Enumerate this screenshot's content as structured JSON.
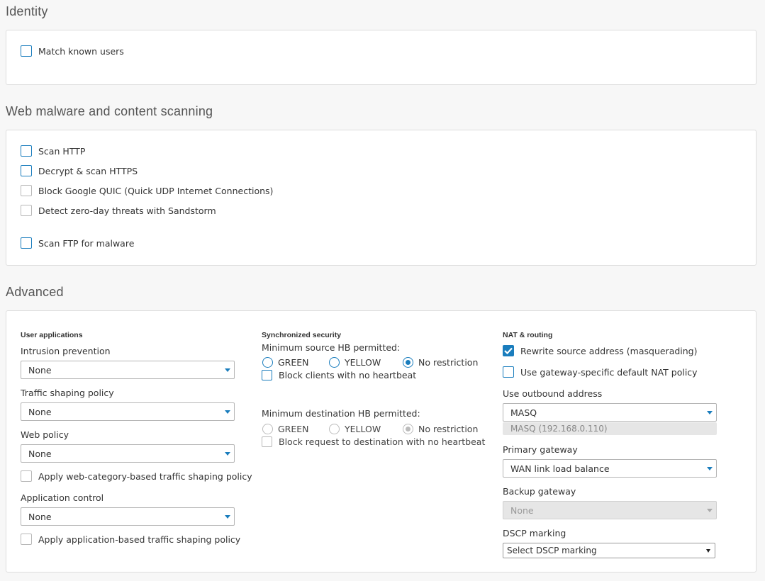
{
  "identity": {
    "title": "Identity",
    "match_known_users": "Match known users"
  },
  "scanning": {
    "title": "Web malware and content scanning",
    "scan_http": "Scan HTTP",
    "decrypt_https": "Decrypt & scan HTTPS",
    "block_quic": "Block Google QUIC (Quick UDP Internet Connections)",
    "zero_day": "Detect zero-day threats with Sandstorm",
    "scan_ftp": "Scan FTP for malware"
  },
  "advanced": {
    "title": "Advanced",
    "user_apps": {
      "heading": "User applications",
      "intrusion_label": "Intrusion prevention",
      "intrusion_value": "None",
      "traffic_label": "Traffic shaping policy",
      "traffic_value": "None",
      "web_policy_label": "Web policy",
      "web_policy_value": "None",
      "web_category_shaping": "Apply web-category-based traffic shaping policy",
      "app_control_label": "Application control",
      "app_control_value": "None",
      "app_shaping": "Apply application-based traffic shaping policy"
    },
    "sync_security": {
      "heading": "Synchronized security",
      "min_source_label": "Minimum source HB permitted:",
      "source_options": [
        "GREEN",
        "YELLOW",
        "No restriction"
      ],
      "source_selected": "No restriction",
      "block_clients": "Block clients with no heartbeat",
      "min_dest_label": "Minimum destination HB permitted:",
      "dest_options": [
        "GREEN",
        "YELLOW",
        "No restriction"
      ],
      "dest_selected": "No restriction",
      "block_request": "Block request to destination with no heartbeat"
    },
    "nat": {
      "heading": "NAT & routing",
      "rewrite_source": "Rewrite source address (masquerading)",
      "rewrite_checked": true,
      "gateway_specific": "Use gateway-specific default NAT policy",
      "outbound_label": "Use outbound address",
      "outbound_value": "MASQ",
      "outbound_sub": "MASQ (192.168.0.110)",
      "primary_label": "Primary gateway",
      "primary_value": "WAN link load balance",
      "backup_label": "Backup gateway",
      "backup_value": "None",
      "dscp_label": "DSCP marking",
      "dscp_value": "Select DSCP marking"
    }
  },
  "colors": {
    "accent": "#1a7dbd",
    "panel_border": "#dddddd",
    "page_bg": "#f7f7f7"
  }
}
